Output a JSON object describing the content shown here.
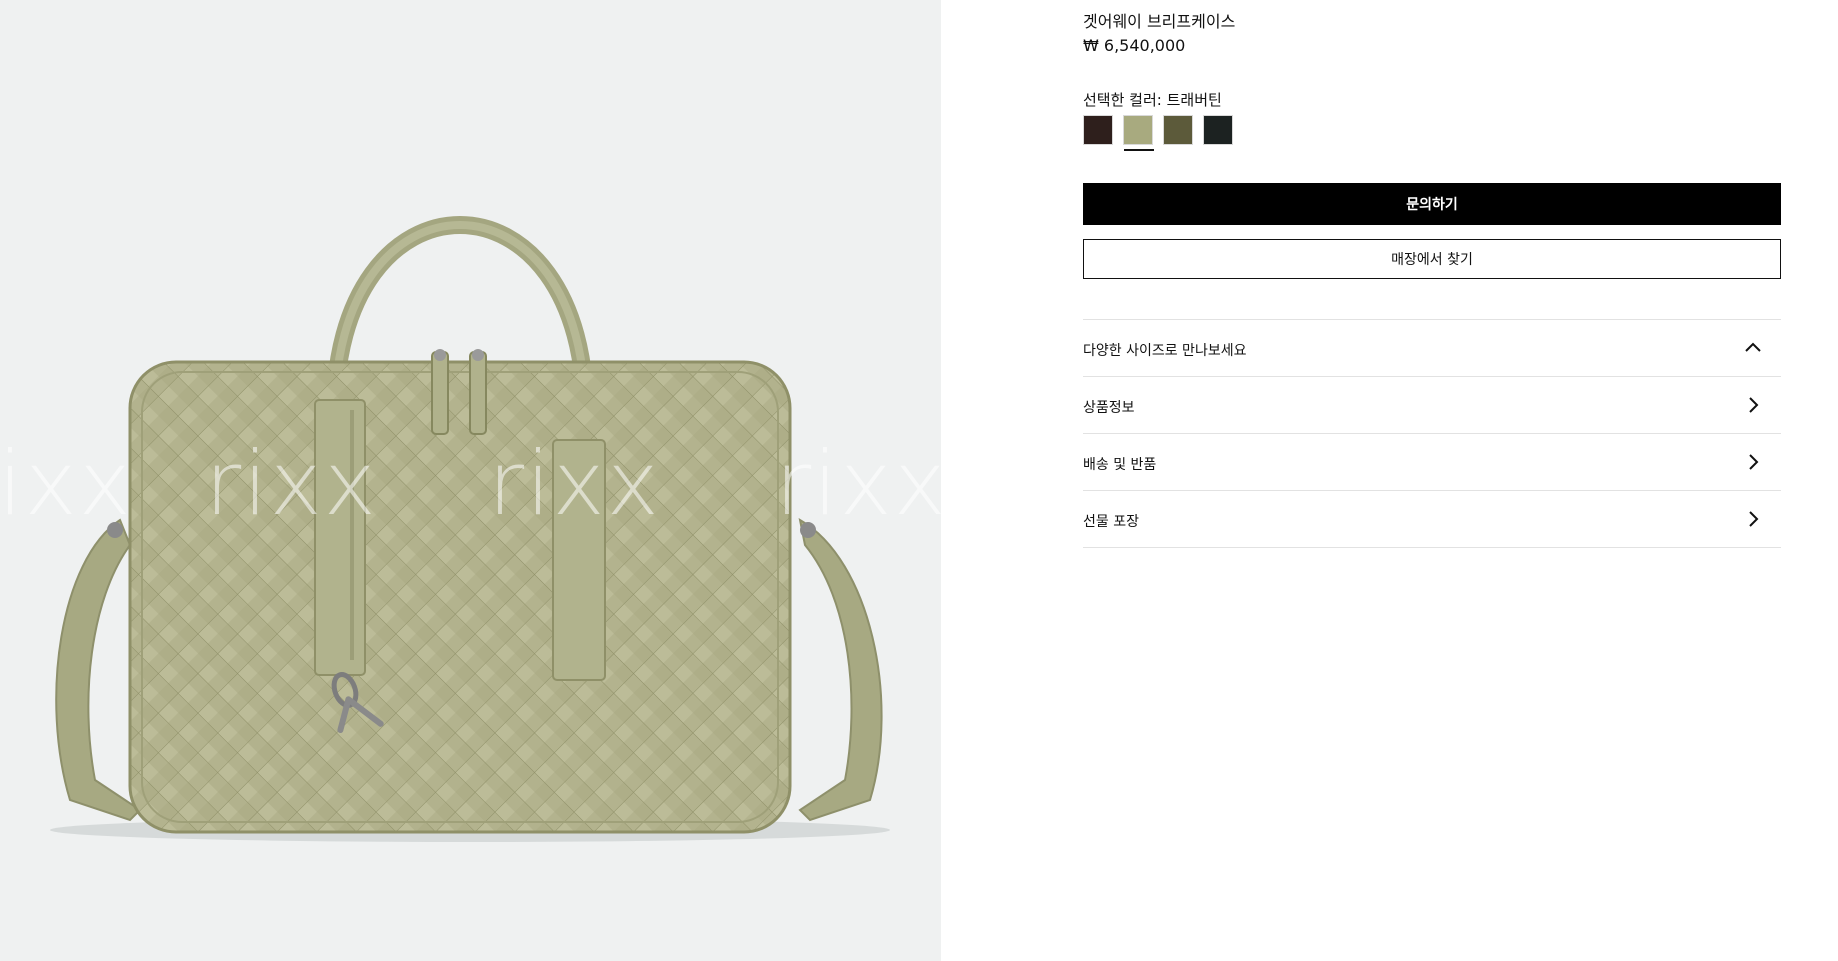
{
  "gallery": {
    "watermark_text": "rixx",
    "image_alt": "Bag"
  },
  "product": {
    "name": "겟어웨이 브리프케이스",
    "price": "₩ 6,540,000",
    "selected_color_label": "선택한 컬러: 트래버틴",
    "swatches": [
      {
        "name": "dark-brown",
        "color": "#2e1f1c",
        "selected": false
      },
      {
        "name": "travertine",
        "color": "#a8aa7f",
        "selected": true
      },
      {
        "name": "olive",
        "color": "#5c5a3a",
        "selected": false
      },
      {
        "name": "black",
        "color": "#1c2221",
        "selected": false
      }
    ]
  },
  "actions": {
    "inquire_label": "문의하기",
    "find_store_label": "매장에서 찾기"
  },
  "accordion": [
    {
      "label": "다양한 사이즈로 만나보세요",
      "icon": "chevron-up-icon"
    },
    {
      "label": "상품정보",
      "icon": "chevron-right-icon"
    },
    {
      "label": "배송 및 반품",
      "icon": "chevron-right-icon"
    },
    {
      "label": "선물 포장",
      "icon": "chevron-right-icon"
    }
  ]
}
